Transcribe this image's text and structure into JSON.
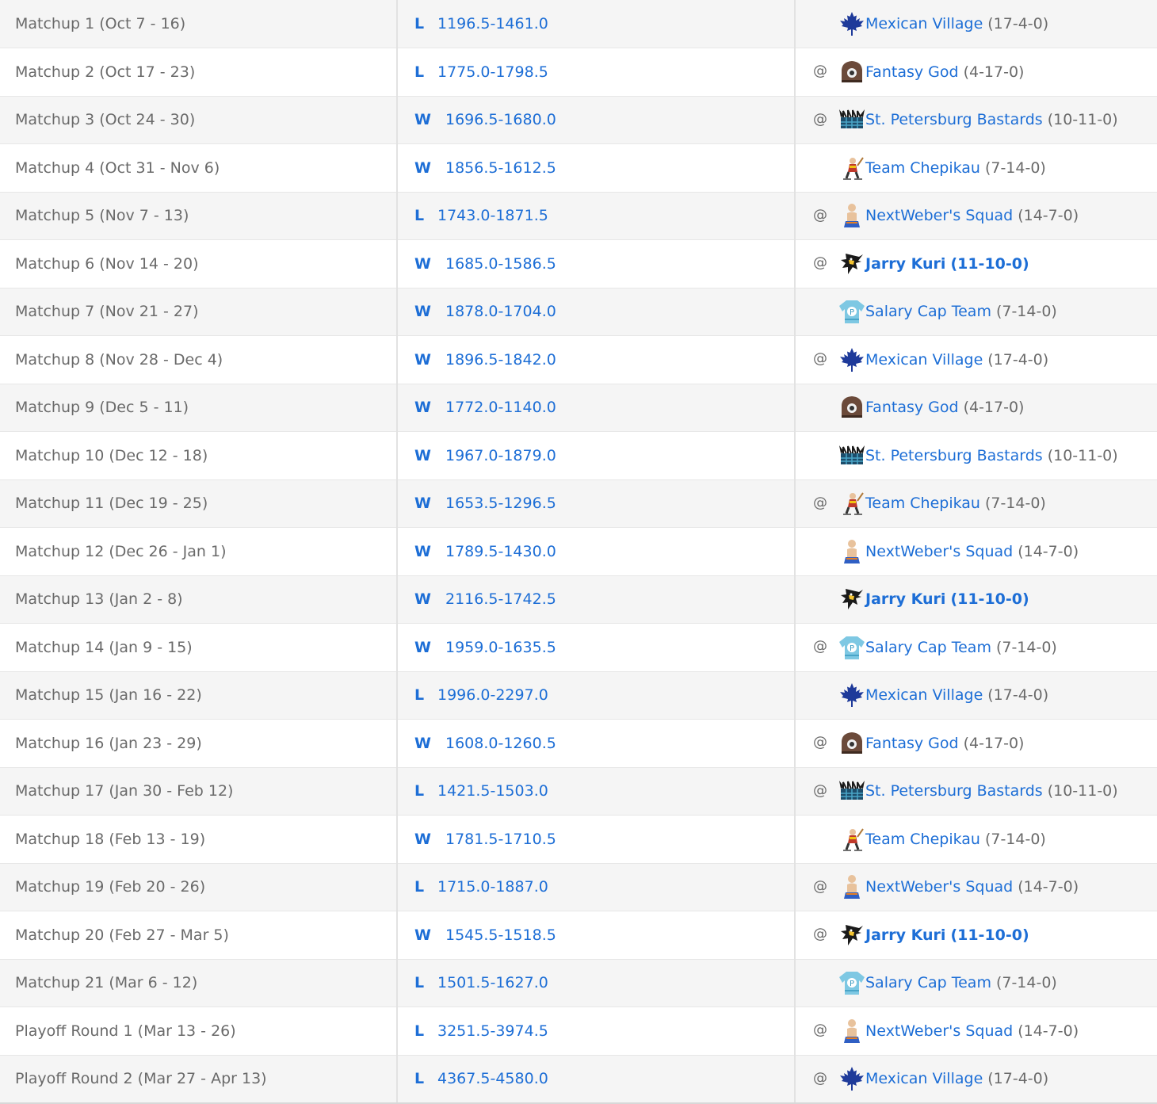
{
  "colors": {
    "link": "#1d6ed6",
    "muted": "#6a6a6a",
    "row_alt": "#f5f5f5"
  },
  "rows": [
    {
      "period": "Matchup 1 (Oct 7 - 16)",
      "result": "L",
      "score": "1196.5-1461.0",
      "away": "",
      "team": "Mexican Village",
      "record": "(17-4-0)",
      "icon": "maple-leaf-icon",
      "bold": false
    },
    {
      "period": "Matchup 2 (Oct 17 - 23)",
      "result": "L",
      "score": "1775.0-1798.5",
      "away": "@",
      "team": "Fantasy God",
      "record": "(4-17-0)",
      "icon": "helmet-icon",
      "bold": false
    },
    {
      "period": "Matchup 3 (Oct 24 - 30)",
      "result": "W",
      "score": "1696.5-1680.0",
      "away": "@",
      "team": "St. Petersburg Bastards",
      "record": "(10-11-0)",
      "icon": "viking-icon",
      "bold": false
    },
    {
      "period": "Matchup 4 (Oct 31 - Nov 6)",
      "result": "W",
      "score": "1856.5-1612.5",
      "away": "",
      "team": "Team Chepikau",
      "record": "(7-14-0)",
      "icon": "skater-icon",
      "bold": false
    },
    {
      "period": "Matchup 5 (Nov 7 - 13)",
      "result": "L",
      "score": "1743.0-1871.5",
      "away": "@",
      "team": "NextWeber's Squad",
      "record": "(14-7-0)",
      "icon": "player-icon",
      "bold": false
    },
    {
      "period": "Matchup 6 (Nov 14 - 20)",
      "result": "W",
      "score": "1685.0-1586.5",
      "away": "@",
      "team": "Jarry Kuri",
      "record": "(11-10-0)",
      "icon": "penguin-icon",
      "bold": true
    },
    {
      "period": "Matchup 7 (Nov 21 - 27)",
      "result": "W",
      "score": "1878.0-1704.0",
      "away": "",
      "team": "Salary Cap Team",
      "record": "(7-14-0)",
      "icon": "jersey-icon",
      "bold": false
    },
    {
      "period": "Matchup 8 (Nov 28 - Dec 4)",
      "result": "W",
      "score": "1896.5-1842.0",
      "away": "@",
      "team": "Mexican Village",
      "record": "(17-4-0)",
      "icon": "maple-leaf-icon",
      "bold": false
    },
    {
      "period": "Matchup 9 (Dec 5 - 11)",
      "result": "W",
      "score": "1772.0-1140.0",
      "away": "",
      "team": "Fantasy God",
      "record": "(4-17-0)",
      "icon": "helmet-icon",
      "bold": false
    },
    {
      "period": "Matchup 10 (Dec 12 - 18)",
      "result": "W",
      "score": "1967.0-1879.0",
      "away": "",
      "team": "St. Petersburg Bastards",
      "record": "(10-11-0)",
      "icon": "viking-icon",
      "bold": false
    },
    {
      "period": "Matchup 11 (Dec 19 - 25)",
      "result": "W",
      "score": "1653.5-1296.5",
      "away": "@",
      "team": "Team Chepikau",
      "record": "(7-14-0)",
      "icon": "skater-icon",
      "bold": false
    },
    {
      "period": "Matchup 12 (Dec 26 - Jan 1)",
      "result": "W",
      "score": "1789.5-1430.0",
      "away": "",
      "team": "NextWeber's Squad",
      "record": "(14-7-0)",
      "icon": "player-icon",
      "bold": false
    },
    {
      "period": "Matchup 13 (Jan 2 - 8)",
      "result": "W",
      "score": "2116.5-1742.5",
      "away": "",
      "team": "Jarry Kuri",
      "record": "(11-10-0)",
      "icon": "penguin-icon",
      "bold": true
    },
    {
      "period": "Matchup 14 (Jan 9 - 15)",
      "result": "W",
      "score": "1959.0-1635.5",
      "away": "@",
      "team": "Salary Cap Team",
      "record": "(7-14-0)",
      "icon": "jersey-icon",
      "bold": false
    },
    {
      "period": "Matchup 15 (Jan 16 - 22)",
      "result": "L",
      "score": "1996.0-2297.0",
      "away": "",
      "team": "Mexican Village",
      "record": "(17-4-0)",
      "icon": "maple-leaf-icon",
      "bold": false
    },
    {
      "period": "Matchup 16 (Jan 23 - 29)",
      "result": "W",
      "score": "1608.0-1260.5",
      "away": "@",
      "team": "Fantasy God",
      "record": "(4-17-0)",
      "icon": "helmet-icon",
      "bold": false
    },
    {
      "period": "Matchup 17 (Jan 30 - Feb 12)",
      "result": "L",
      "score": "1421.5-1503.0",
      "away": "@",
      "team": "St. Petersburg Bastards",
      "record": "(10-11-0)",
      "icon": "viking-icon",
      "bold": false
    },
    {
      "period": "Matchup 18 (Feb 13 - 19)",
      "result": "W",
      "score": "1781.5-1710.5",
      "away": "",
      "team": "Team Chepikau",
      "record": "(7-14-0)",
      "icon": "skater-icon",
      "bold": false
    },
    {
      "period": "Matchup 19 (Feb 20 - 26)",
      "result": "L",
      "score": "1715.0-1887.0",
      "away": "@",
      "team": "NextWeber's Squad",
      "record": "(14-7-0)",
      "icon": "player-icon",
      "bold": false
    },
    {
      "period": "Matchup 20 (Feb 27 - Mar 5)",
      "result": "W",
      "score": "1545.5-1518.5",
      "away": "@",
      "team": "Jarry Kuri",
      "record": "(11-10-0)",
      "icon": "penguin-icon",
      "bold": true
    },
    {
      "period": "Matchup 21 (Mar 6 - 12)",
      "result": "L",
      "score": "1501.5-1627.0",
      "away": "",
      "team": "Salary Cap Team",
      "record": "(7-14-0)",
      "icon": "jersey-icon",
      "bold": false
    },
    {
      "period": "Playoff Round 1 (Mar 13 - 26)",
      "result": "L",
      "score": "3251.5-3974.5",
      "away": "@",
      "team": "NextWeber's Squad",
      "record": "(14-7-0)",
      "icon": "player-icon",
      "bold": false
    },
    {
      "period": "Playoff Round 2 (Mar 27 - Apr 13)",
      "result": "L",
      "score": "4367.5-4580.0",
      "away": "@",
      "team": "Mexican Village",
      "record": "(17-4-0)",
      "icon": "maple-leaf-icon",
      "bold": false
    }
  ]
}
